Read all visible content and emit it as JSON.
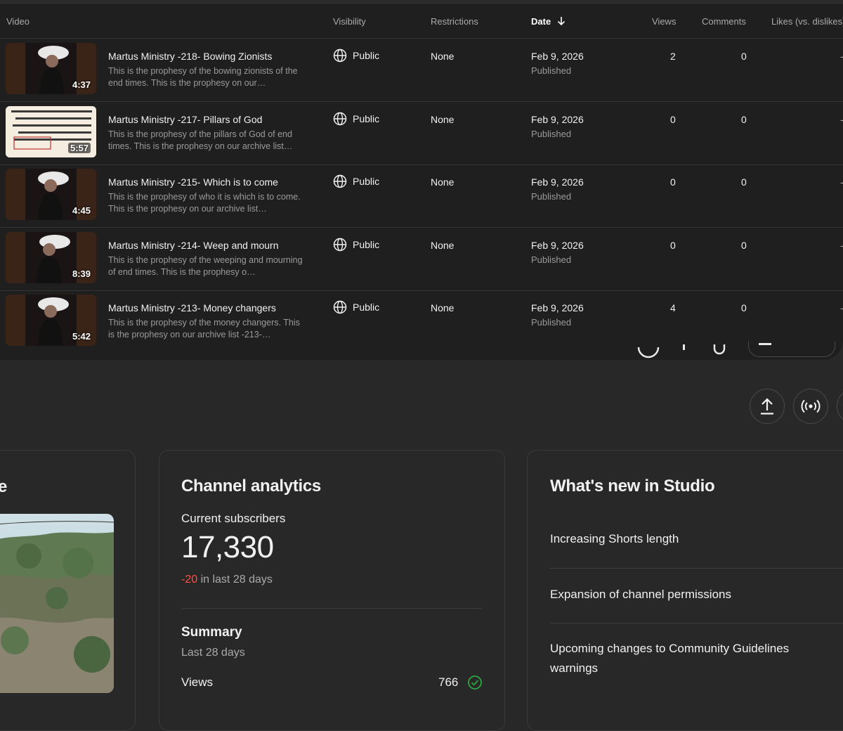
{
  "table": {
    "headers": {
      "video": "Video",
      "visibility": "Visibility",
      "restrictions": "Restrictions",
      "date": "Date",
      "views": "Views",
      "comments": "Comments",
      "likes": "Likes (vs. dislikes)"
    },
    "rows": [
      {
        "title": "Martus Ministry -218- Bowing Zionists",
        "description": "This is the prophesy of the bowing zionists of the end times. This is the prophesy on our…",
        "duration": "4:37",
        "visibility": "Public",
        "restrictions": "None",
        "date": "Feb 9, 2026",
        "status": "Published",
        "views": "2",
        "comments": "0",
        "likes": "-"
      },
      {
        "title": "Martus Ministry -217- Pillars of God",
        "description": "This is the prophesy of the pillars of God of end times. This is the prophesy on our archive list…",
        "duration": "5:57",
        "visibility": "Public",
        "restrictions": "None",
        "date": "Feb 9, 2026",
        "status": "Published",
        "views": "0",
        "comments": "0",
        "likes": "-"
      },
      {
        "title": "Martus Ministry -215- Which is to come",
        "description": "This is the prophesy of who it is which is to come. This is the prophesy on our archive list…",
        "duration": "4:45",
        "visibility": "Public",
        "restrictions": "None",
        "date": "Feb 9, 2026",
        "status": "Published",
        "views": "0",
        "comments": "0",
        "likes": "-"
      },
      {
        "title": "Martus Ministry -214- Weep and mourn",
        "description": "This is the prophesy of the weeping and mourning of end times. This is the prophesy o…",
        "duration": "8:39",
        "visibility": "Public",
        "restrictions": "None",
        "date": "Feb 9, 2026",
        "status": "Published",
        "views": "0",
        "comments": "0",
        "likes": "-"
      },
      {
        "title": "Martus Ministry -213- Money changers",
        "description": "This is the prophesy of the money changers. This is the prophesy on our archive list -213-…",
        "duration": "5:42",
        "visibility": "Public",
        "restrictions": "None",
        "date": "Feb 9, 2026",
        "status": "Published",
        "views": "4",
        "comments": "0",
        "likes": "-"
      }
    ]
  },
  "left_card": {
    "title_fragment": "e"
  },
  "analytics": {
    "title": "Channel analytics",
    "subscribers_label": "Current subscribers",
    "subscribers_value": "17,330",
    "change_value": "-20",
    "change_suffix": "in last 28 days",
    "summary_title": "Summary",
    "summary_period": "Last 28 days",
    "views_label": "Views",
    "views_value": "766"
  },
  "whats_new": {
    "title": "What's new in Studio",
    "items": [
      "Increasing Shorts length",
      "Expansion of channel permissions",
      "Upcoming changes to Community Guidelines warnings"
    ]
  },
  "colors": {
    "negative": "#ff4e45",
    "positive": "#2ba640"
  },
  "icons": {
    "visibility": "globe-icon",
    "upload": "upload-icon",
    "live": "live-broadcast-icon",
    "sort": "arrow-down-icon",
    "check": "check-circle-icon"
  }
}
